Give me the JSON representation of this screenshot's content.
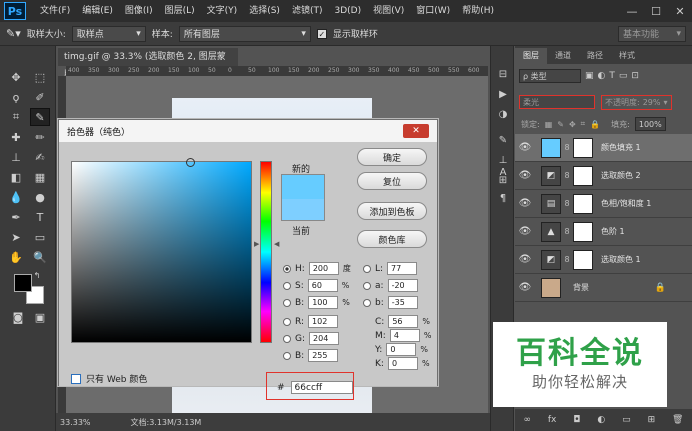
{
  "menubar": {
    "logo": "Ps",
    "items": [
      "文件(F)",
      "编辑(E)",
      "图像(I)",
      "图层(L)",
      "文字(Y)",
      "选择(S)",
      "滤镜(T)",
      "3D(D)",
      "视图(V)",
      "窗口(W)",
      "帮助(H)"
    ],
    "window_controls": [
      "—",
      "☐",
      "✕"
    ]
  },
  "options_bar": {
    "sample_size_label": "取样大小:",
    "sample_size_value": "取样点",
    "sample_label": "样本:",
    "sample_value": "所有图层",
    "show_ring_label": "显示取样环",
    "workspace": "基本功能"
  },
  "document": {
    "tab_title": "timg.gif @ 33.3% (选取颜色 2, 图层蒙版/8) *",
    "ruler_marks": [
      "400",
      "350",
      "300",
      "250",
      "200",
      "150",
      "100",
      "50",
      "0",
      "50",
      "100",
      "150",
      "200",
      "250",
      "300",
      "350",
      "400",
      "450",
      "500",
      "550",
      "600"
    ],
    "zoom": "33.33%",
    "doc_info": "文档:3.13M/3.13M"
  },
  "color_picker": {
    "title": "拾色器（纯色）",
    "new_label": "新的",
    "current_label": "当前",
    "colors": {
      "new": "#66ccff",
      "current": "#7ecfff"
    },
    "buttons": [
      "确定",
      "复位",
      "添加到色板",
      "颜色库"
    ],
    "hsb": [
      {
        "key": "H:",
        "value": "200",
        "unit": "度",
        "selected": true
      },
      {
        "key": "S:",
        "value": "60",
        "unit": "%",
        "selected": false
      },
      {
        "key": "B:",
        "value": "100",
        "unit": "%",
        "selected": false
      }
    ],
    "rgb": [
      {
        "key": "R:",
        "value": "102"
      },
      {
        "key": "G:",
        "value": "204"
      },
      {
        "key": "B:",
        "value": "255"
      }
    ],
    "lab": [
      {
        "key": "L:",
        "value": "77"
      },
      {
        "key": "a:",
        "value": "-20"
      },
      {
        "key": "b:",
        "value": "-35"
      }
    ],
    "cmyk": [
      {
        "key": "C:",
        "value": "56",
        "unit": "%"
      },
      {
        "key": "M:",
        "value": "4",
        "unit": "%"
      },
      {
        "key": "Y:",
        "value": "0",
        "unit": "%"
      },
      {
        "key": "K:",
        "value": "0",
        "unit": "%"
      }
    ],
    "hex_label": "#",
    "hex_value": "66ccff",
    "web_only_label": "只有 Web 颜色"
  },
  "layers_panel": {
    "tabs": [
      "图层",
      "通道",
      "路径",
      "样式"
    ],
    "filter_kind": "ρ 类型",
    "blend_mode": "柔光",
    "opacity_label": "不透明度:",
    "opacity_value": "29%",
    "lock_label": "锁定:",
    "fill_label": "填充:",
    "fill_value": "100%",
    "layers": [
      {
        "name": "颜色填充 1",
        "thumb": "■",
        "mask": true,
        "selected": true
      },
      {
        "name": "选取颜色 2",
        "thumb": "◩",
        "mask": true,
        "selected": false
      },
      {
        "name": "色相/饱和度 1",
        "thumb": "▤",
        "mask": true,
        "selected": false
      },
      {
        "name": "色阶 1",
        "thumb": "▲",
        "mask": true,
        "selected": false
      },
      {
        "name": "选取颜色 1",
        "thumb": "◩",
        "mask": true,
        "selected": false
      },
      {
        "name": "背景",
        "thumb": "",
        "mask": false,
        "selected": false,
        "locked": true
      }
    ],
    "footer_icons": [
      "∞",
      "fx",
      "◘",
      "◐",
      "▭",
      "⊞",
      "🗑"
    ]
  },
  "watermark": {
    "title": "百科全说",
    "subtitle": "助你轻松解决"
  }
}
